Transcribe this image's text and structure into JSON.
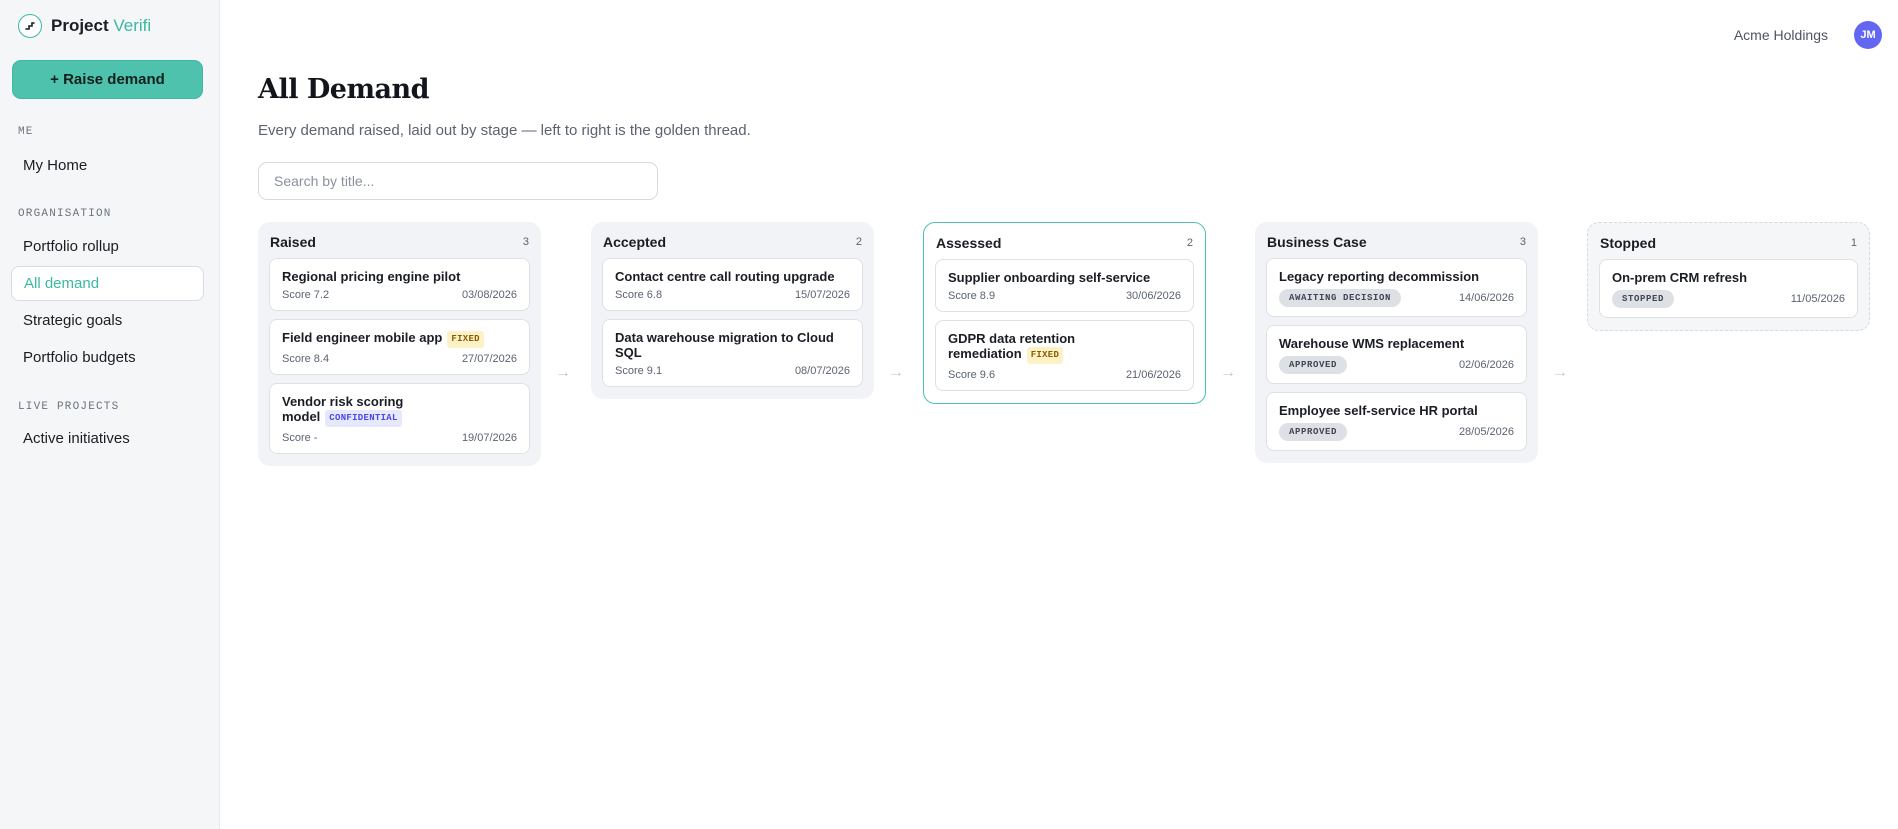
{
  "brand": {
    "name": "Project",
    "accent": "Verifi"
  },
  "sidebar": {
    "raise_label": "+ Raise demand",
    "sections": [
      {
        "label": "ME",
        "items": [
          {
            "label": "My Home"
          }
        ]
      },
      {
        "label": "ORGANISATION",
        "items": [
          {
            "label": "Portfolio rollup"
          },
          {
            "label": "All demand",
            "active": true
          },
          {
            "label": "Strategic goals"
          },
          {
            "label": "Portfolio budgets"
          }
        ]
      },
      {
        "label": "LIVE PROJECTS",
        "items": [
          {
            "label": "Active initiatives"
          }
        ]
      }
    ]
  },
  "header": {
    "org": "Acme Holdings",
    "avatar_initials": "JM",
    "avatar_color": "#6366f1"
  },
  "page": {
    "title": "All Demand",
    "subtitle": "Every demand raised, laid out by stage — left to right is the golden thread.",
    "search_placeholder": "Search by title..."
  },
  "colors": {
    "accent": "#3cb8a2",
    "button": "#4ec2ad"
  },
  "columns": [
    {
      "title": "Raised",
      "count": "3",
      "cards": [
        {
          "title": "Regional pricing engine pilot",
          "score": "Score 7.2",
          "date": "03/08/2026"
        },
        {
          "title": "Field engineer mobile app",
          "tag": "FIXED",
          "score": "Score 8.4",
          "date": "27/07/2026"
        },
        {
          "title": "Vendor risk scoring model",
          "tag": "CONFIDENTIAL",
          "score": "Score -",
          "date": "19/07/2026"
        }
      ]
    },
    {
      "title": "Accepted",
      "count": "2",
      "cards": [
        {
          "title": "Contact centre call routing upgrade",
          "score": "Score 6.8",
          "date": "15/07/2026"
        },
        {
          "title": "Data warehouse migration to Cloud SQL",
          "score": "Score 9.1",
          "date": "08/07/2026"
        }
      ]
    },
    {
      "title": "Assessed",
      "count": "2",
      "cards": [
        {
          "title": "Supplier onboarding self-service",
          "score": "Score 8.9",
          "date": "30/06/2026"
        },
        {
          "title": "GDPR data retention remediation",
          "tag": "FIXED",
          "score": "Score 9.6",
          "date": "21/06/2026"
        }
      ]
    },
    {
      "title": "Business Case",
      "count": "3",
      "cards": [
        {
          "title": "Legacy reporting decommission",
          "status": "AWAITING DECISION",
          "date": "14/06/2026"
        },
        {
          "title": "Warehouse WMS replacement",
          "status": "APPROVED",
          "date": "02/06/2026"
        },
        {
          "title": "Employee self-service HR portal",
          "status": "APPROVED",
          "date": "28/05/2026"
        }
      ]
    },
    {
      "title": "Stopped",
      "count": "1",
      "cards": [
        {
          "title": "On-prem CRM refresh",
          "status": "STOPPED",
          "date": "11/05/2026"
        }
      ]
    }
  ],
  "arrow_glyph": "→"
}
